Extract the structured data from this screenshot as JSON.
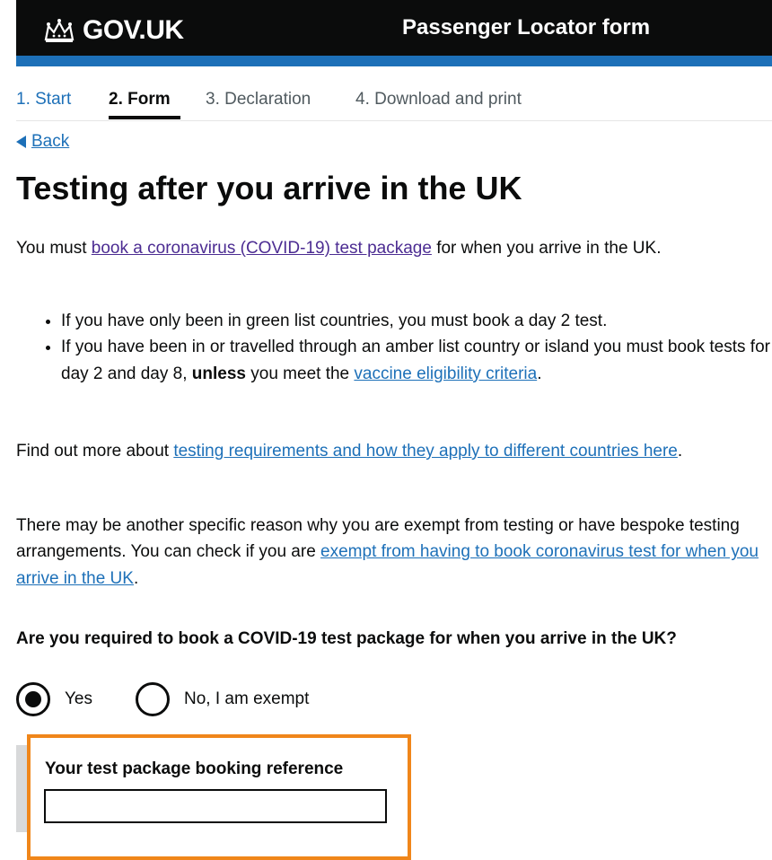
{
  "header": {
    "logo_text": "GOV.UK",
    "service_name": "Passenger Locator form",
    "colors": {
      "background": "#0b0c0c",
      "bar": "#1d70b8"
    }
  },
  "steps": [
    {
      "label": "1. Start",
      "state": "link"
    },
    {
      "label": "2. Form",
      "state": "current"
    },
    {
      "label": "3. Declaration",
      "state": "inactive"
    },
    {
      "label": "4. Download and print",
      "state": "inactive"
    }
  ],
  "back": {
    "label": "Back"
  },
  "page": {
    "title": "Testing after you arrive in the UK",
    "intro_prefix": "You must ",
    "intro_link": "book a coronavirus (COVID-19) test package",
    "intro_suffix": " for when you arrive in the UK.",
    "bullet1": "If you have only been in green list countries, you must book a day 2 test.",
    "bullet2_prefix": "If you have been in or travelled through an amber list country or island you must book tests for day 2 and day 8, ",
    "bullet2_bold": "unless",
    "bullet2_mid": " you meet the ",
    "bullet2_link": "vaccine eligibility criteria",
    "bullet2_suffix": ".",
    "findout_prefix": "Find out more about ",
    "findout_link": "testing requirements and how they apply to different countries here",
    "findout_suffix": ".",
    "exempt_prefix": "There may be another specific reason why you are exempt from testing or have bespoke testing arrangements. You can check if you are ",
    "exempt_link": "exempt from having to book coronavirus test for when you arrive in the UK",
    "exempt_suffix": "."
  },
  "question": {
    "label": "Are you required to book a COVID-19 test package for when you arrive in the UK?",
    "options": [
      {
        "label": "Yes",
        "checked": true
      },
      {
        "label": "No, I am exempt",
        "checked": false
      }
    ]
  },
  "booking_reference": {
    "label": "Your test package booking reference",
    "value": ""
  },
  "highlight_color": "#f0861a"
}
